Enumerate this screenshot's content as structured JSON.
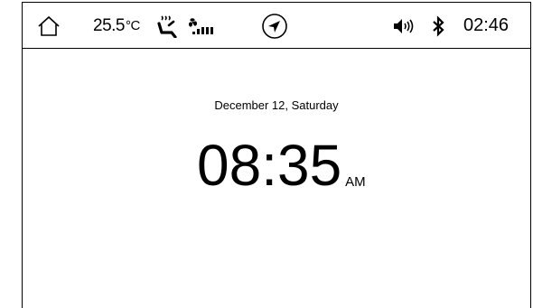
{
  "status_bar": {
    "home_icon": "home-icon",
    "temperature": "25.5",
    "temperature_unit": "°C",
    "heated_seat_icon": "heated-seat-icon",
    "fan_speed_icon": "fan-speed-icon",
    "navigation_icon": "navigation-icon",
    "volume_icon": "volume-icon",
    "bluetooth_icon": "bluetooth-icon",
    "time": "02:46"
  },
  "main": {
    "date": "December 12, Saturday",
    "time": "08:35",
    "ampm": "AM"
  }
}
